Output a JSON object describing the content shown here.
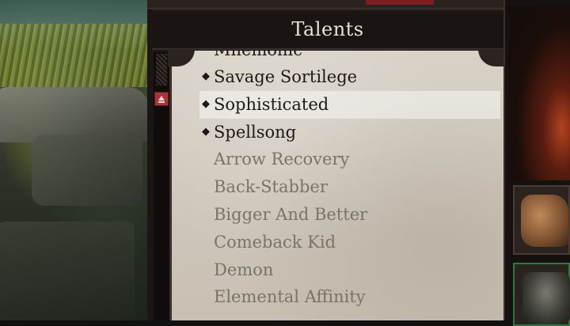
{
  "panel": {
    "title": "Talents"
  },
  "talents": [
    {
      "label": "Mnemonic",
      "owned": true,
      "partial": true
    },
    {
      "label": "Savage Sortilege",
      "owned": true,
      "bullet": "◆"
    },
    {
      "label": "Sophisticated",
      "owned": true,
      "bullet": "◆",
      "highlighted": true
    },
    {
      "label": "Spellsong",
      "owned": true,
      "bullet": "◆"
    },
    {
      "label": "Arrow Recovery",
      "owned": false
    },
    {
      "label": "Back-Stabber",
      "owned": false
    },
    {
      "label": "Bigger And Better",
      "owned": false
    },
    {
      "label": "Comeback Kid",
      "owned": false
    },
    {
      "label": "Demon",
      "owned": false
    },
    {
      "label": "Elemental Affinity",
      "owned": false
    }
  ],
  "equipment": {
    "slots": [
      {
        "name": "gloves-icon"
      },
      {
        "name": "chest-armor-icon"
      }
    ]
  },
  "colors": {
    "owned_text": "#1e1916",
    "unowned_text": "#7a7468",
    "scroll_thumb": "#a8353a",
    "header_bg": "#1a1513",
    "parchment": "#d8d2c7"
  }
}
